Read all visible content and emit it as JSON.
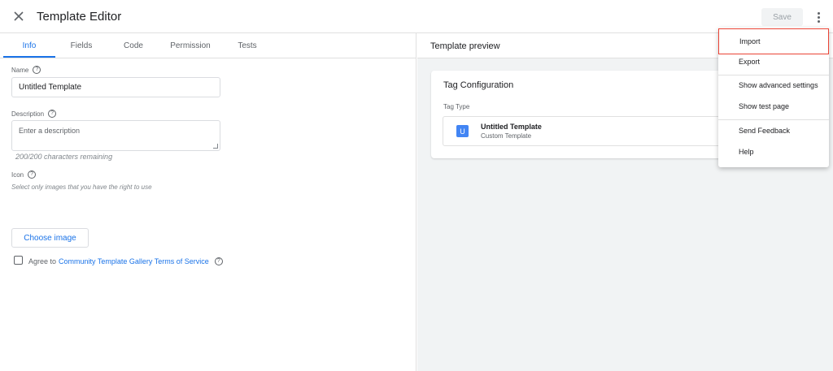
{
  "header": {
    "title": "Template Editor",
    "save_label": "Save"
  },
  "tabs": [
    {
      "label": "Info"
    },
    {
      "label": "Fields"
    },
    {
      "label": "Code"
    },
    {
      "label": "Permission"
    },
    {
      "label": "Tests"
    }
  ],
  "info": {
    "name_label": "Name",
    "name_value": "Untitled Template",
    "description_label": "Description",
    "description_placeholder": "Enter a description",
    "chars_remaining": "200/200 characters remaining",
    "icon_label": "Icon",
    "icon_hint": "Select only images that you have the right to use",
    "choose_image_label": "Choose image",
    "agree_prefix": "Agree to",
    "agree_link": "Community Template Gallery Terms of Service",
    "help_glyph": "?"
  },
  "preview": {
    "title": "Template preview",
    "card_title": "Tag Configuration",
    "tag_type_label": "Tag Type",
    "tag_icon_letter": "U",
    "tag_name": "Untitled Template",
    "tag_sub": "Custom Template"
  },
  "menu": {
    "items": [
      {
        "label": "Import"
      },
      {
        "label": "Export"
      },
      {
        "label": "Show advanced settings"
      },
      {
        "label": "Show test page"
      },
      {
        "label": "Send Feedback"
      },
      {
        "label": "Help"
      }
    ]
  },
  "colors": {
    "accent": "#1a73e8",
    "highlight": "#ea4335",
    "tag_icon": "#4285f4"
  }
}
